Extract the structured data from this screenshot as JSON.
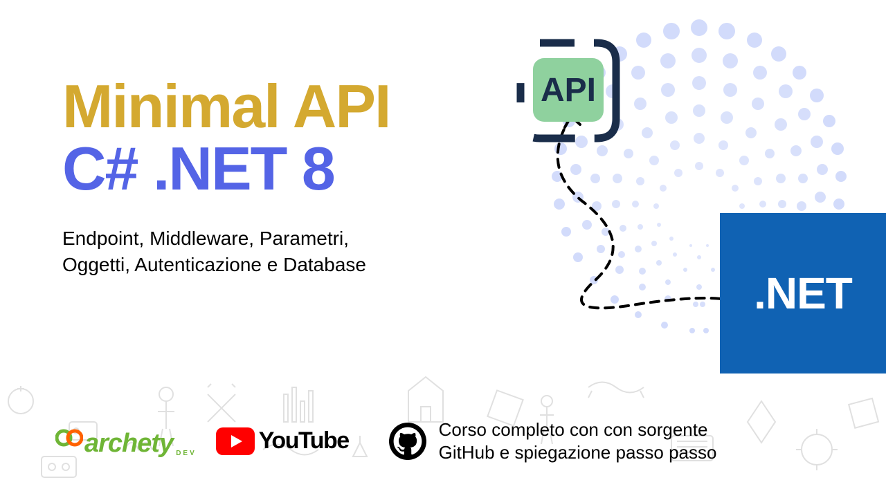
{
  "title": {
    "line1": "Minimal API",
    "line2": "C# .NET 8"
  },
  "subtitle": {
    "line1": "Endpoint, Middleware, Parametri,",
    "line2": "Oggetti, Autenticazione e Database"
  },
  "api_badge": {
    "label": "API"
  },
  "dotnet": {
    "label": ".NET"
  },
  "brands": {
    "archety": {
      "name": "archety",
      "suffix": "DEV"
    },
    "youtube": {
      "name": "YouTube"
    }
  },
  "github": {
    "line1": "Corso completo con con sorgente",
    "line2": "GitHub e spiegazione passo passo"
  },
  "colors": {
    "gold": "#d4a930",
    "indigo": "#5464e6",
    "green": "#6fb536",
    "youtube_red": "#ff0000",
    "dotnet_blue": "#1062b3",
    "halftone": "#d2dbfb"
  }
}
